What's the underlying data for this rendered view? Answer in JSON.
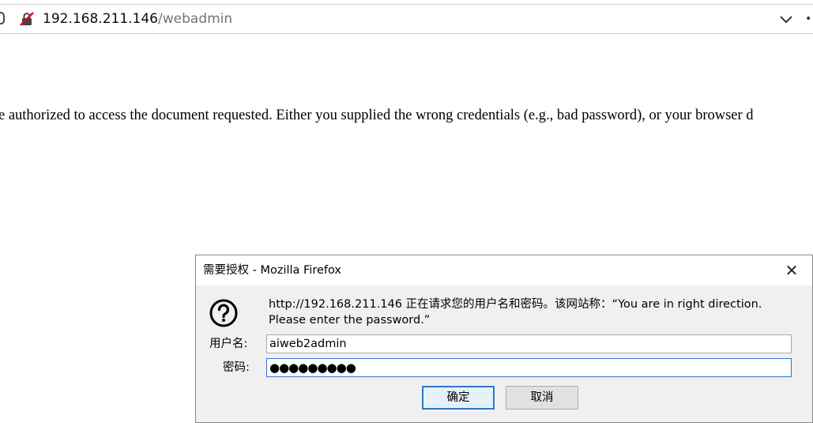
{
  "browser": {
    "url_host": "192.168.211.146",
    "url_path": "/webadmin"
  },
  "page": {
    "message": "e authorized to access the document requested. Either you supplied the wrong credentials (e.g., bad password), or your browser d"
  },
  "dialog": {
    "title": "需要授权 - Mozilla Firefox",
    "close_glyph": "✕",
    "message_line1": "http://192.168.211.146 正在请求您的用户名和密码。该网站称：“You are in right direction.",
    "message_line2": "Please enter the password.”",
    "username_label": "用户名:",
    "username_value": "aiweb2admin",
    "password_label": "密码:",
    "password_value": "●●●●●●●●●",
    "ok_label": "确定",
    "cancel_label": "取消"
  },
  "icons": {
    "insecure": "insecure-connection-icon",
    "question": "question-icon",
    "dropdown": "chevron-down-icon"
  },
  "colors": {
    "focus_border": "#2e74cf",
    "insecure_red": "#d70022"
  }
}
